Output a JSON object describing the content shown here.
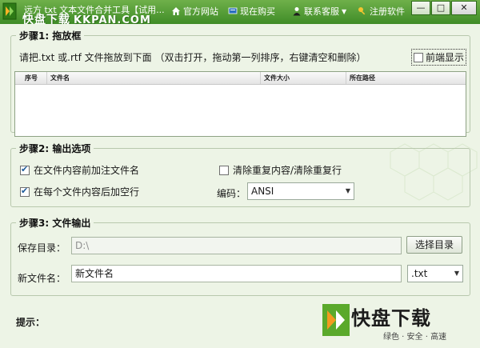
{
  "window": {
    "title": "远方 txt 文本文件合并工具【试用...",
    "watermark_brand": "快盘下载",
    "watermark_site": "KKPAN.COM",
    "controls": {
      "minimize": "—",
      "maximize": "□",
      "close": "✕"
    }
  },
  "menu": {
    "items": [
      {
        "label": "官方网站",
        "icon": "home-icon"
      },
      {
        "label": "现在购买",
        "icon": "cart-icon"
      },
      {
        "label": "联系客服",
        "icon": "person-icon"
      },
      {
        "label": "注册软件",
        "icon": "key-icon"
      }
    ]
  },
  "step1": {
    "title": "步骤1: 拖放框",
    "instruction": "请把.txt 或.rtf 文件拖放到下面 （双击打开，拖动第一列排序，右键清空和删除）",
    "front_display": {
      "label": "前端显示",
      "checked": false
    },
    "list_columns": [
      "序号",
      "文件名",
      "文件大小",
      "所在路径"
    ],
    "rows": []
  },
  "step2": {
    "title": "步骤2: 输出选项",
    "options": [
      {
        "label": "在文件内容前加注文件名",
        "checked": true
      },
      {
        "label": "在每个文件内容后加空行",
        "checked": true
      },
      {
        "label": "清除重复内容/清除重复行",
        "checked": false
      }
    ],
    "encoding_label": "编码：",
    "encoding_value": "ANSI"
  },
  "step3": {
    "title": "步骤3: 文件输出",
    "save_dir_label": "保存目录：",
    "save_dir_value": "D:\\",
    "choose_dir_button": "选择目录",
    "new_filename_label": "新文件名：",
    "new_filename_value": "新文件名",
    "extension_value": ".txt"
  },
  "hint_label": "提示：",
  "logo": {
    "text": "快盘下载",
    "tagline": "绿色 · 安全 · 高速",
    "colors": {
      "green": "#5aa92b",
      "orange": "#f39a1e"
    }
  },
  "colors": {
    "titlebar": "#4f9a33",
    "background": "#edf4e6"
  }
}
